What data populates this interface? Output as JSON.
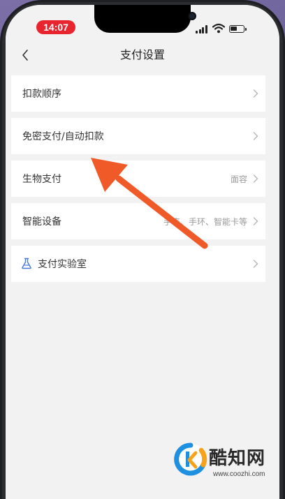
{
  "status_bar": {
    "time": "14:07",
    "icons": [
      "signal-icon",
      "wifi-icon",
      "battery-icon"
    ]
  },
  "nav": {
    "back_icon": "chevron-left-icon",
    "title": "支付设置"
  },
  "settings": {
    "items": [
      {
        "label": "扣款顺序",
        "value": ""
      },
      {
        "label": "免密支付/自动扣款",
        "value": ""
      },
      {
        "label": "生物支付",
        "value": "面容"
      },
      {
        "label": "智能设备",
        "value": "手表、手环、智能卡等"
      },
      {
        "label": "支付实验室",
        "value": "",
        "icon": "flask-icon"
      }
    ]
  },
  "annotation": {
    "arrow_color": "#f05a28"
  },
  "watermark": {
    "name": "酷知网",
    "url": "www.coozhi.com"
  },
  "colors": {
    "background": "#f2f2f2",
    "row_bg": "#ffffff",
    "time_pill": "#e8242e"
  }
}
